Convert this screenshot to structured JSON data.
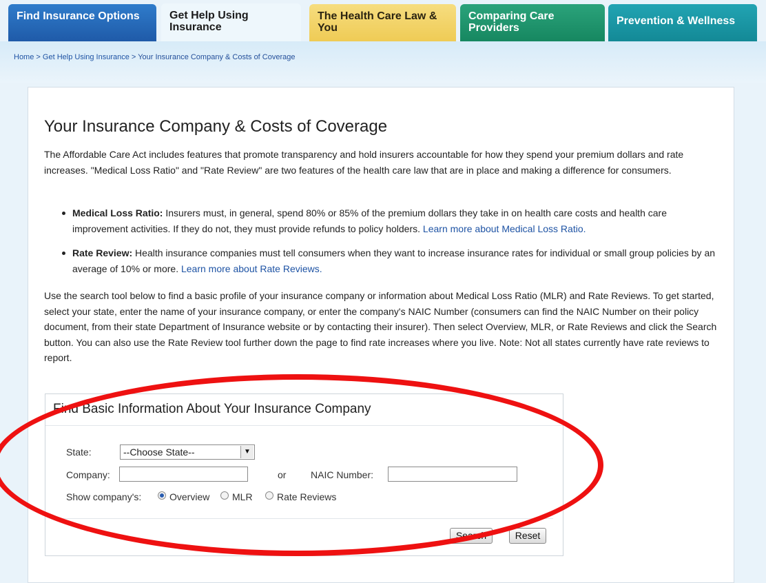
{
  "nav": {
    "tabs": [
      {
        "label": "Find Insurance Options"
      },
      {
        "label": "Get Help Using Insurance"
      },
      {
        "label": "The Health Care Law & You"
      },
      {
        "label": "Comparing Care Providers"
      },
      {
        "label": "Prevention & Wellness"
      }
    ],
    "active_tab": "Get Help Using Insurance"
  },
  "breadcrumb": {
    "items": [
      "Home",
      "Get Help Using Insurance",
      "Your Insurance Company & Costs of Coverage"
    ],
    "separator": ">"
  },
  "page": {
    "title": "Your Insurance Company & Costs of Coverage",
    "intro": "The Affordable Care Act includes features that promote transparency and hold insurers accountable for how they spend your premium dollars and rate increases. \"Medical Loss Ratio\" and \"Rate Review\" are two features of the health care law that are in place and making a difference for consumers.",
    "bullets": [
      {
        "term": "Medical Loss Ratio:",
        "text": " Insurers must, in general, spend 80% or 85% of the premium dollars they take in on health care costs and health care improvement activities. If they do not, they must provide refunds to policy holders. ",
        "link": "Learn more about Medical Loss Ratio."
      },
      {
        "term": "Rate Review:",
        "text": " Health insurance companies must tell consumers when they want to increase insurance rates for individual or small group policies by an average of 10% or more. ",
        "link": "Learn more about Rate Reviews."
      }
    ],
    "instructions": "Use the search tool below to find a basic profile of your insurance company or information about Medical Loss Ratio (MLR) and Rate Reviews. To get started, select your state, enter the name of your insurance company, or enter the company's NAIC Number (consumers can find the NAIC Number on their policy document, from their state Department of Insurance website or by contacting their insurer). Then select Overview, MLR, or Rate Reviews and click the Search button. You can also use the Rate Review tool further down the page to find rate increases where you live. Note: Not all states currently have rate reviews to report."
  },
  "finder": {
    "title": "Find Basic Information About Your Insurance Company",
    "state_label": "State:",
    "state_value": "--Choose State--",
    "company_label": "Company:",
    "company_value": "",
    "or_label": "or",
    "naic_label": "NAIC Number:",
    "naic_value": "",
    "show_label": "Show company's:",
    "options": [
      "Overview",
      "MLR",
      "Rate Reviews"
    ],
    "selected_option": "Overview",
    "search_button": "Search",
    "reset_button": "Reset"
  },
  "annotation": {
    "color": "#ee1111",
    "shape": "ellipse"
  }
}
